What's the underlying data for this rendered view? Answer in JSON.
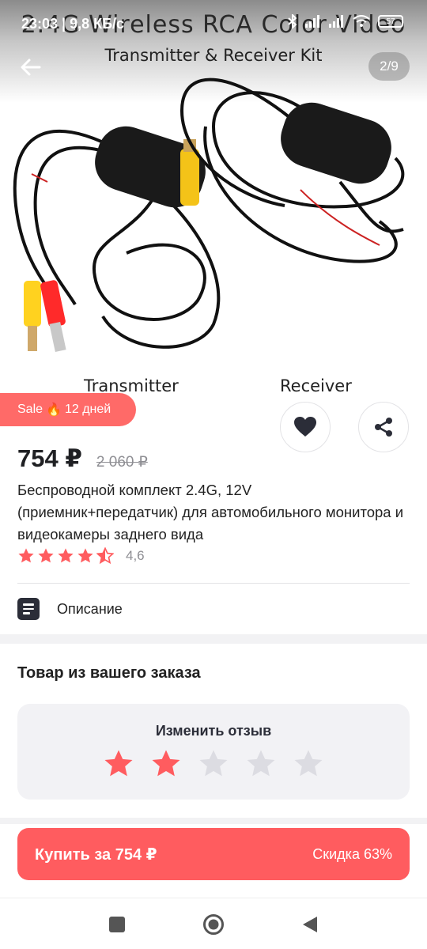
{
  "status_bar": {
    "time": "23:03 | 9,8 КБ/с",
    "battery": "57"
  },
  "gallery": {
    "image_title_line1": "2.4G Wireless RCA Color Video",
    "image_title_line2": "Transmitter & Receiver Kit",
    "caption_left": "Transmitter",
    "caption_right": "Receiver",
    "counter": "2/9",
    "back_icon": "arrow-left-icon"
  },
  "sale_badge": {
    "label": "Sale",
    "emoji": "🔥",
    "duration": "12 дней"
  },
  "actions": {
    "favorite_icon": "heart-icon",
    "share_icon": "share-icon"
  },
  "price": {
    "current": "754 ₽",
    "old": "2 060 ₽"
  },
  "product": {
    "title": "Беспроводной комплект 2.4G, 12V (приемник+передатчик) для автомобильного монитора и видеокамеры заднего вида",
    "rating": "4,6",
    "rating_value": 4.6
  },
  "description": {
    "label": "Описание",
    "icon": "document-icon"
  },
  "order_section": {
    "title": "Товар из вашего заказа",
    "review_label": "Изменить отзыв",
    "review_stars_selected": 2,
    "review_stars_total": 5
  },
  "buy": {
    "label": "Купить за 754 ₽",
    "discount": "Скидка 63%"
  },
  "colors": {
    "accent": "#ff5c5f",
    "star": "#ff5c5f",
    "star_empty": "#dcdce2"
  }
}
